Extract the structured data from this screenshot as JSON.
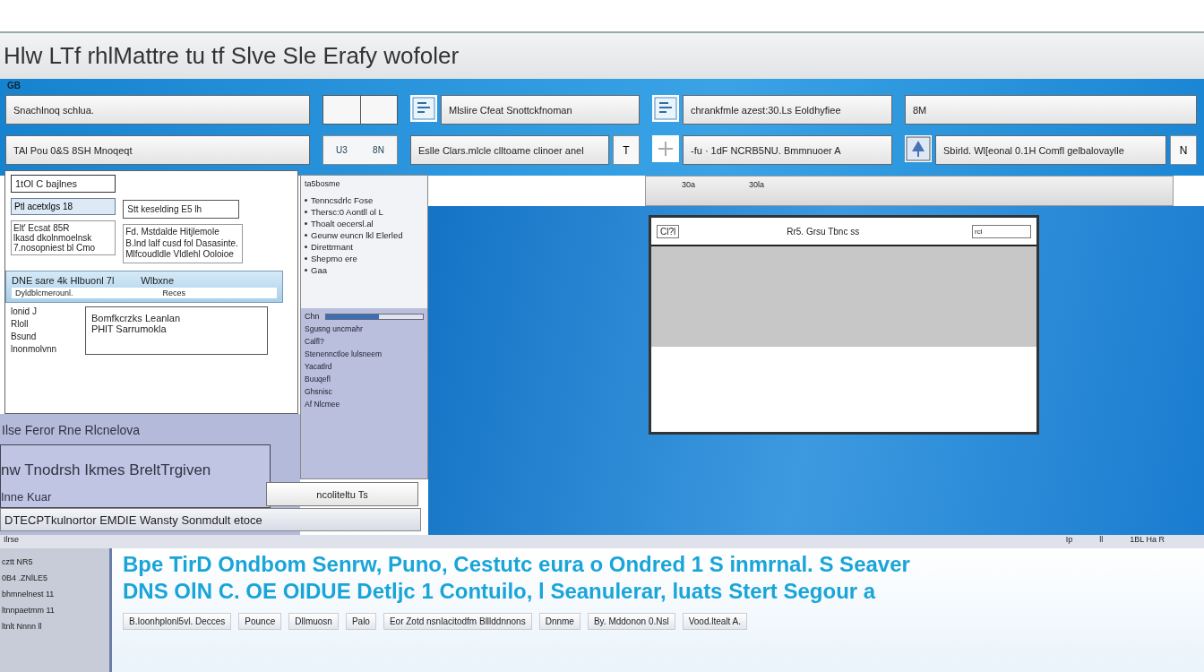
{
  "title": "Hlw LTf rhlMattre  tu  tf  Slve  Sle  Erafy wofoler",
  "band": {
    "label": "GB",
    "rows": [
      [
        {
          "kind": "field",
          "text": "Snachlnoq schlua."
        },
        {
          "kind": "split"
        },
        {
          "kind": "icon_field",
          "text": "Mlslire Cfeat Snottckfnoman"
        },
        {
          "kind": "icon_field",
          "text": "chrankfmle azest:30.Ls  Eoldhyfiee"
        },
        {
          "kind": "field",
          "text": "8M"
        }
      ],
      [
        {
          "kind": "close_field",
          "text": "TAl Pou 0&S 8SH Mnoqeqt"
        },
        {
          "kind": "pair",
          "text": "U3",
          "text_2": "8N"
        },
        {
          "kind": "button_field",
          "text": "Eslle Clars.mlcle clltoame clinoer anel",
          "button": "T"
        },
        {
          "kind": "plus_field",
          "text": "-fu · 1dF NCRB5NU. Bmmnuoer A"
        },
        {
          "kind": "picture_field",
          "text": "Sbirld. Wl[eonal 0.1H Comfl gelbalovaylle",
          "button": "N"
        }
      ]
    ]
  },
  "left_window": {
    "heading": "1tOl C bajlnes",
    "button": "Ptl acetxlgs 18",
    "group": [
      "Elt' Ecsat 85R",
      "lkasd dkolnmoelnsk",
      "7.nosopniest bl Cmo"
    ],
    "field": "Stt keselding E5 lh",
    "paragraph": "Fd. Mstdalde Hitjlemole B.lnd lalf cusd fol Dasasinte. Mlfcoudldle Vldlehl Ooloioe",
    "bar": {
      "title": "DNE sare 4k Hlbuonl 7l",
      "title_2": "Wlbxne",
      "sub": "Dyldblcmerounl.",
      "sub_2": "Reces"
    },
    "lower_items": [
      "lonid J",
      "Rloll",
      "Bsund",
      "lnonmolvnn"
    ],
    "card": [
      "Bomfkcrzks Leanlan",
      "PHlT Sarrumokla"
    ]
  },
  "list_panel": {
    "header": "ta5bosme",
    "items": [
      "Tenncsdrlc Fose",
      "Thersc:0 Aontll ol L",
      "Thoalt oecersl.al",
      "Geunw euncn lkl Elerled",
      "Direttrmant",
      "Shepmo ere",
      "Gaa"
    ],
    "slider": {
      "label": "Chn",
      "level": 0.55
    },
    "lower_items": [
      "Sgusng uncrnahr",
      "Calfl?",
      "Stenennctloe lulsneem",
      "Yacatlrd",
      "Buuqefl",
      "Ghsnisc",
      "Af Nlcmee"
    ]
  },
  "gray_bar": [
    "30a",
    "30la"
  ],
  "dialog": {
    "label": "Cl?l",
    "title": "Rr5. Grsu Tbnc ss",
    "search": "rcl"
  },
  "lower_left": {
    "lines": [
      "Ilse Feror Rne Rlcnelova",
      "nw Tnodrsh Ikmes BreltTrgiven",
      "Inne Kuar"
    ],
    "strip": "DTECPTkulnortor EMDIE Wansty Sonmdult etoce",
    "box": "ncoliteltu Ts"
  },
  "status_bar": {
    "left": "Ilrse",
    "right": [
      "Ip",
      "ll",
      "1BL Ha R"
    ]
  },
  "bottom": {
    "side_items": [
      "cztt  NR5",
      "0B4 .ZNlLE5",
      "bhmnelnest 11",
      "ltnnpaetmm 11",
      "ltnlt Nnnn ll"
    ],
    "headlines": [
      "Bpe TirD Ondbom Senrw, Puno, Cestutc eura o Ondred 1 S inmrnal. S Seaver",
      "DNS OlN C.  OE OIDUE Detljc 1  Contuilo, l Seanulerar, luats  Stert  Segour a"
    ],
    "taskbar": [
      "B.Ioonhplonl5vl. Decces",
      "Pounce",
      "Dllmuosn",
      "Palo",
      "Eor Zotd nsnlacitodfm Blllddnnons",
      "Dnnme",
      "By. Mddonon 0.Nsl",
      "Vood.ltealt A."
    ]
  }
}
